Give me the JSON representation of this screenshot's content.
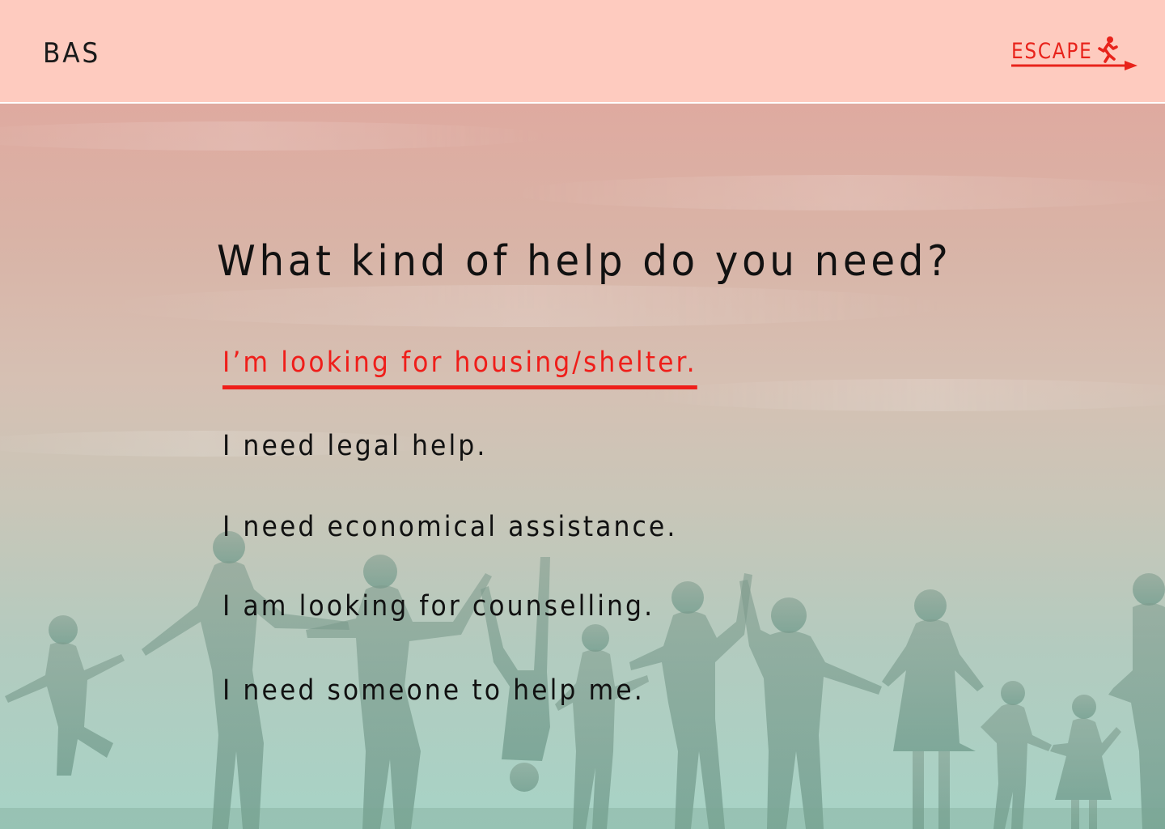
{
  "header": {
    "brand": "BAS",
    "escape_label": "ESCAPE",
    "accent": "#e8231b",
    "background": "#fecbbf"
  },
  "main": {
    "question": "What kind of help do you need?",
    "options": [
      {
        "label": "I’m looking for housing/shelter.",
        "selected": true
      },
      {
        "label": "I need legal help.",
        "selected": false
      },
      {
        "label": "I need economical assistance.",
        "selected": false
      },
      {
        "label": "I am looking for counselling.",
        "selected": false
      },
      {
        "label": "I need someone to help me.",
        "selected": false
      }
    ],
    "selected_color": "#ef1e1a"
  },
  "icons": {
    "escape": "running-person-icon",
    "arrow": "arrow-right-icon"
  }
}
